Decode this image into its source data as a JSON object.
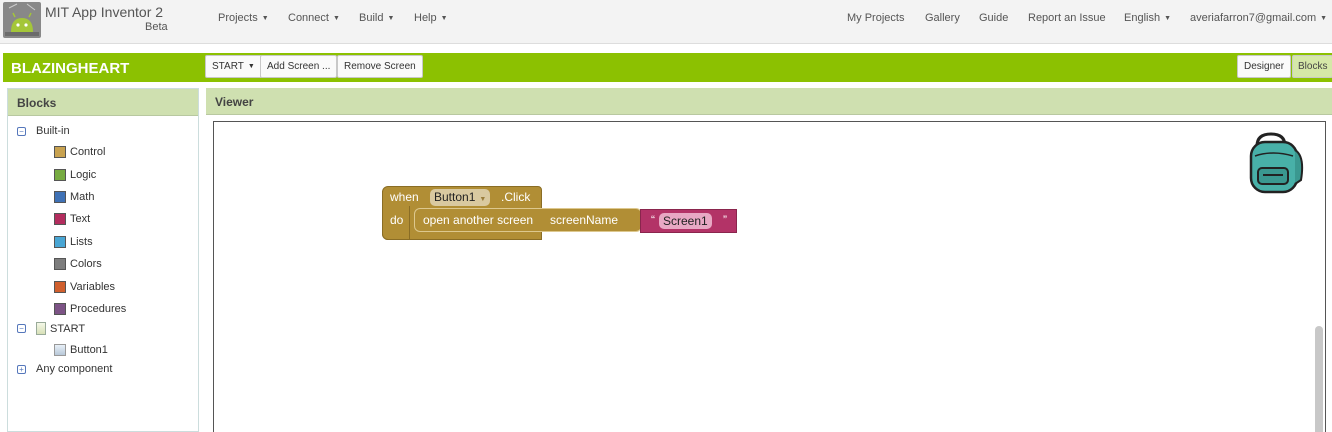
{
  "app": {
    "title": "MIT App Inventor 2",
    "beta": "Beta",
    "logo_icon": "android-robot-icon"
  },
  "menu": {
    "left": [
      "Projects",
      "Connect",
      "Build",
      "Help"
    ],
    "right": [
      "My Projects",
      "Gallery",
      "Guide",
      "Report an Issue"
    ],
    "language": "English",
    "user": "averiafarron7@gmail.com"
  },
  "toolbar": {
    "project_name": "BLAZINGHEART",
    "screen_select": "START",
    "add_screen": "Add Screen ...",
    "remove_screen": "Remove Screen",
    "designer": "Designer",
    "blocks": "Blocks",
    "active_view": "Blocks",
    "bg_color": "#8cc101"
  },
  "blocks_panel": {
    "title": "Blocks",
    "builtin_label": "Built-in",
    "builtin": [
      {
        "label": "Control",
        "color": "#c8a250"
      },
      {
        "label": "Logic",
        "color": "#77ab41"
      },
      {
        "label": "Math",
        "color": "#3f71b5"
      },
      {
        "label": "Text",
        "color": "#b32d5e"
      },
      {
        "label": "Lists",
        "color": "#49a6d4"
      },
      {
        "label": "Colors",
        "color": "#7d7d7d"
      },
      {
        "label": "Variables",
        "color": "#d05f2d"
      },
      {
        "label": "Procedures",
        "color": "#7c5385"
      }
    ],
    "screen_label": "START",
    "components": [
      "Button1"
    ],
    "any_component": "Any component"
  },
  "viewer": {
    "title": "Viewer",
    "event_block": {
      "when": "when",
      "component": "Button1",
      "event": ".Click",
      "do": "do",
      "color": "#b18e35"
    },
    "call_block": {
      "label": "open another screen",
      "param": "screenName"
    },
    "text_block": {
      "open_quote": "“",
      "value": "Screen1",
      "close_quote": "”",
      "color": "#b33367"
    },
    "backpack_icon": "backpack-icon"
  }
}
